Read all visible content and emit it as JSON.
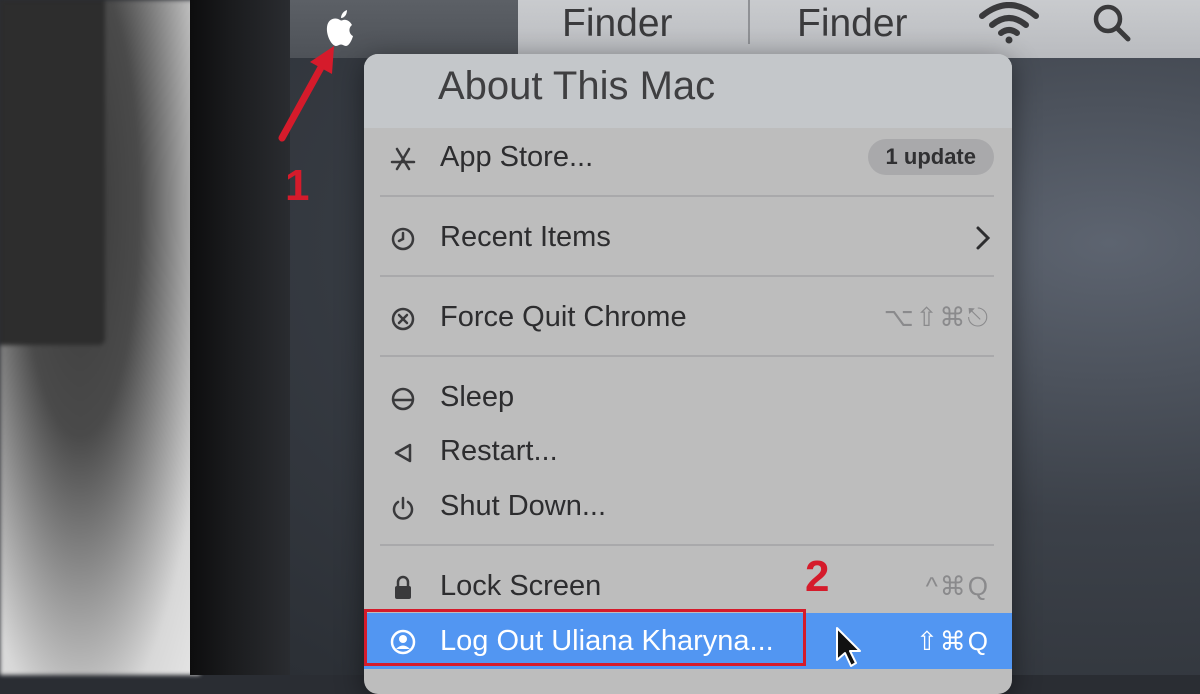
{
  "menubar": {
    "app_name": "Finder",
    "menu_title": "Finder"
  },
  "apple_menu": {
    "about": "About This Mac",
    "items": [
      {
        "label": "App Store...",
        "icon": "app-store-icon",
        "badge": "1 update"
      },
      {
        "label": "Recent Items",
        "icon": "clock-icon",
        "submenu": ">"
      },
      {
        "label": "Force Quit Chrome",
        "icon": "force-quit-icon",
        "shortcut": "⌥⇧⌘⎋"
      },
      {
        "label": "Sleep",
        "icon": "sleep-icon"
      },
      {
        "label": "Restart...",
        "icon": "restart-icon"
      },
      {
        "label": "Shut Down...",
        "icon": "power-icon"
      },
      {
        "label": "Lock Screen",
        "icon": "lock-icon",
        "shortcut": "^⌘Q"
      },
      {
        "label": "Log Out Uliana Kharyna...",
        "icon": "user-icon",
        "shortcut": "⇧⌘Q"
      }
    ]
  },
  "annotations": {
    "step1": "1",
    "step2": "2"
  },
  "colors": {
    "highlight": "#5296f2",
    "annotation_red": "#d51b2b",
    "menu_bg": "#bdbdbd"
  }
}
